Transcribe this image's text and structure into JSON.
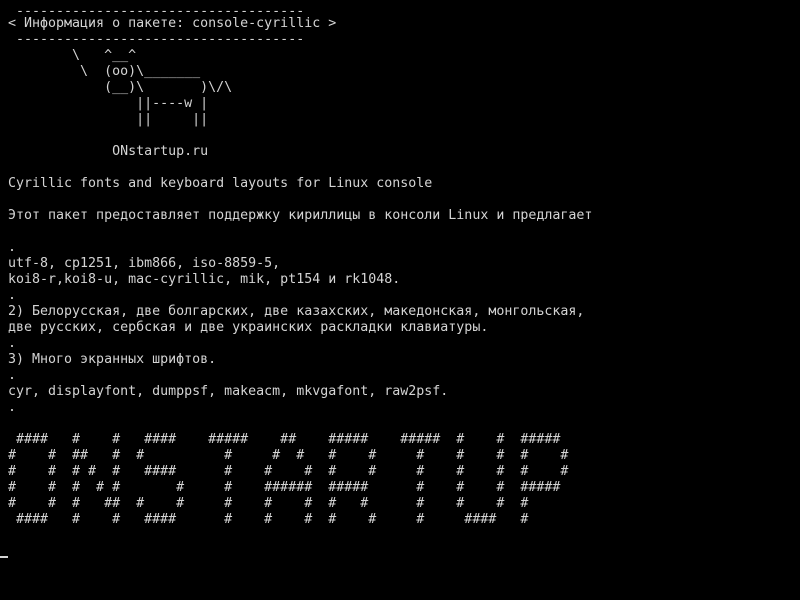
{
  "colors": {
    "background": "#000000",
    "foreground": "#d4d4d4"
  },
  "terminal": {
    "lines": [
      " ------------------------------------",
      "< Информация о пакете: console-cyrillic >",
      " ------------------------------------",
      "        \\   ^__^",
      "         \\  (oo)\\_______",
      "            (__)\\       )\\/\\",
      "                ||----w |",
      "                ||     ||",
      "",
      "             ONstartup.ru",
      "",
      "Cyrillic fonts and keyboard layouts for Linux console",
      "",
      "Этот пакет предоставляет поддержку кириллицы в консоли Linux и предлагает",
      "",
      ".",
      "utf-8, cp1251, ibm866, iso-8859-5,",
      "koi8-r,koi8-u, mac-cyrillic, mik, pt154 и rk1048.",
      ".",
      "2) Белорусская, две болгарских, две казахских, македонская, монгольская,",
      "две русских, сербская и две украинских раскладки клавиатуры.",
      ".",
      "3) Много экранных шрифтов.",
      ".",
      "cyr, displayfont, dumppsf, makeacm, mkvgafont, raw2psf.",
      ".",
      "",
      " ####   #    #   ####    #####    ##    #####    #####  #    #  #####",
      "#    #  ##   #  #          #     #  #   #    #     #    #    #  #    #",
      "#    #  # #  #   ####      #    #    #  #    #     #    #    #  #    #",
      "#    #  #  # #       #     #    ######  #####      #    #    #  #####",
      "#    #  #   ##  #    #     #    #    #  #   #      #    #    #  #",
      " ####   #    #   ####      #    #    #  #    #     #     ####   #"
    ]
  }
}
